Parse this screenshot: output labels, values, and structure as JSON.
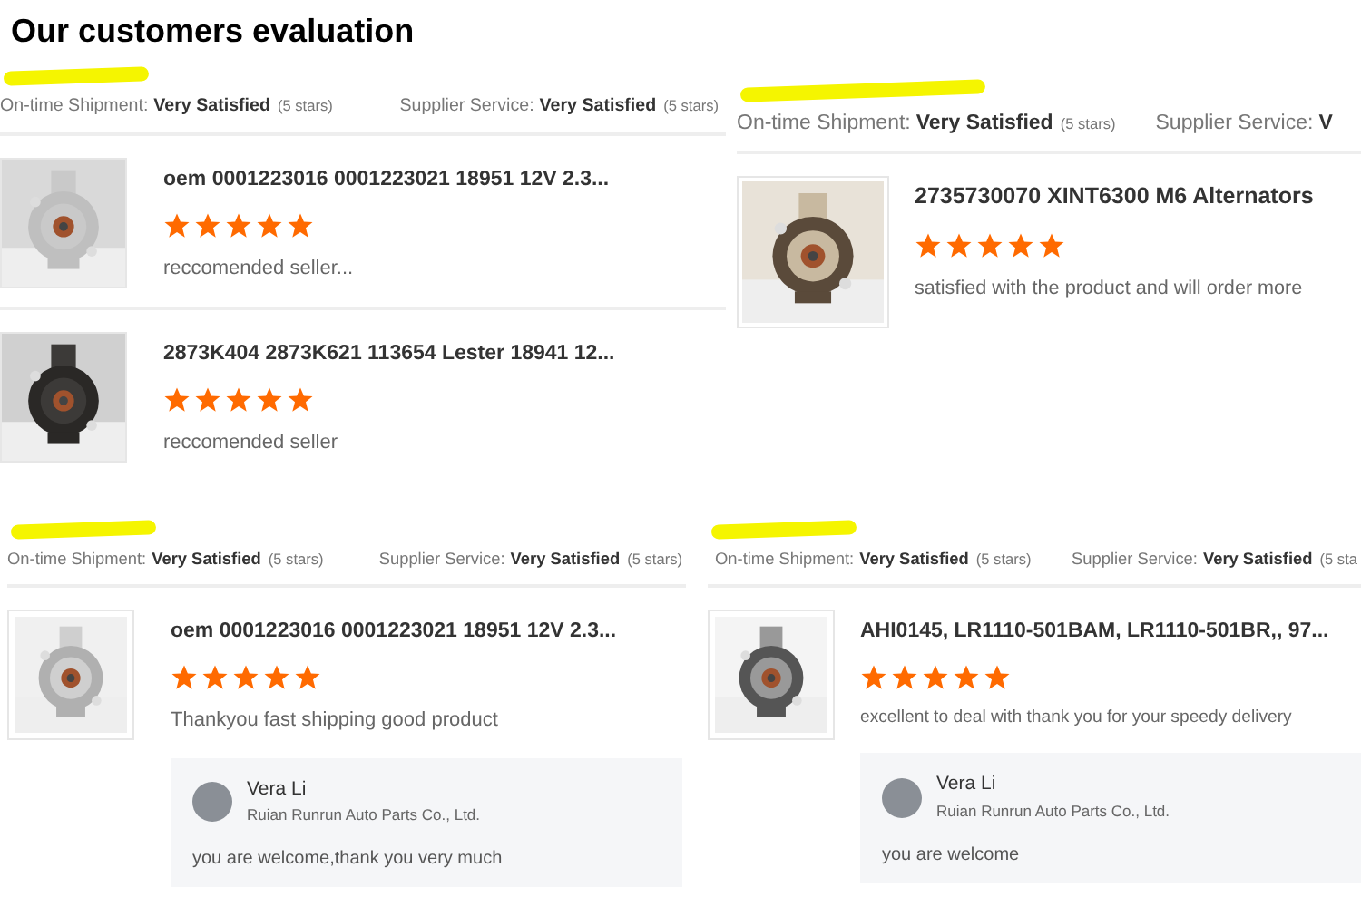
{
  "title": "Our customers evaluation",
  "panels": [
    {
      "ratings": [
        {
          "label": "On-time Shipment:",
          "value": "Very Satisfied",
          "note": "(5 stars)"
        },
        {
          "label": "Supplier Service:",
          "value": "Very Satisfied",
          "note": "(5 stars)"
        }
      ],
      "reviews": [
        {
          "product": "oem 0001223016 0001223021 18951 12V 2.3...",
          "stars": 5,
          "comment": "reccomended seller..."
        },
        {
          "product": "2873K404 2873K621 113654 Lester 18941 12...",
          "stars": 5,
          "comment": "reccomended seller"
        }
      ]
    },
    {
      "ratings": [
        {
          "label": "On-time Shipment:",
          "value": "Very Satisfied",
          "note": "(5 stars)"
        },
        {
          "label": "Supplier Service:",
          "value": "V"
        }
      ],
      "reviews": [
        {
          "product": "2735730070 XINT6300 M6 Alternators",
          "stars": 5,
          "comment": "satisfied with the product and will order more"
        }
      ]
    },
    {
      "ratings": [
        {
          "label": "On-time Shipment:",
          "value": "Very Satisfied",
          "note": "(5 stars)"
        },
        {
          "label": "Supplier Service:",
          "value": "Very Satisfied",
          "note": "(5 stars)"
        }
      ],
      "reviews": [
        {
          "product": "oem 0001223016 0001223021 18951 12V 2.3...",
          "stars": 5,
          "comment": "Thankyou fast shipping good product",
          "reply": {
            "name": "Vera Li",
            "company": "Ruian Runrun Auto Parts Co., Ltd.",
            "text": "you are welcome,thank you very much"
          }
        }
      ]
    },
    {
      "ratings": [
        {
          "label": "On-time Shipment:",
          "value": "Very Satisfied",
          "note": "(5 stars)"
        },
        {
          "label": "Supplier Service:",
          "value": "Very Satisfied",
          "note": "(5 sta"
        }
      ],
      "reviews": [
        {
          "product": "AHI0145, LR1110-501BAM, LR1110-501BR,, 97...",
          "stars": 5,
          "comment": "excellent to deal with thank you for your speedy delivery",
          "reply": {
            "name": "Vera Li",
            "company": "Ruian Runrun Auto Parts Co., Ltd.",
            "text": "you are welcome"
          }
        }
      ]
    }
  ]
}
